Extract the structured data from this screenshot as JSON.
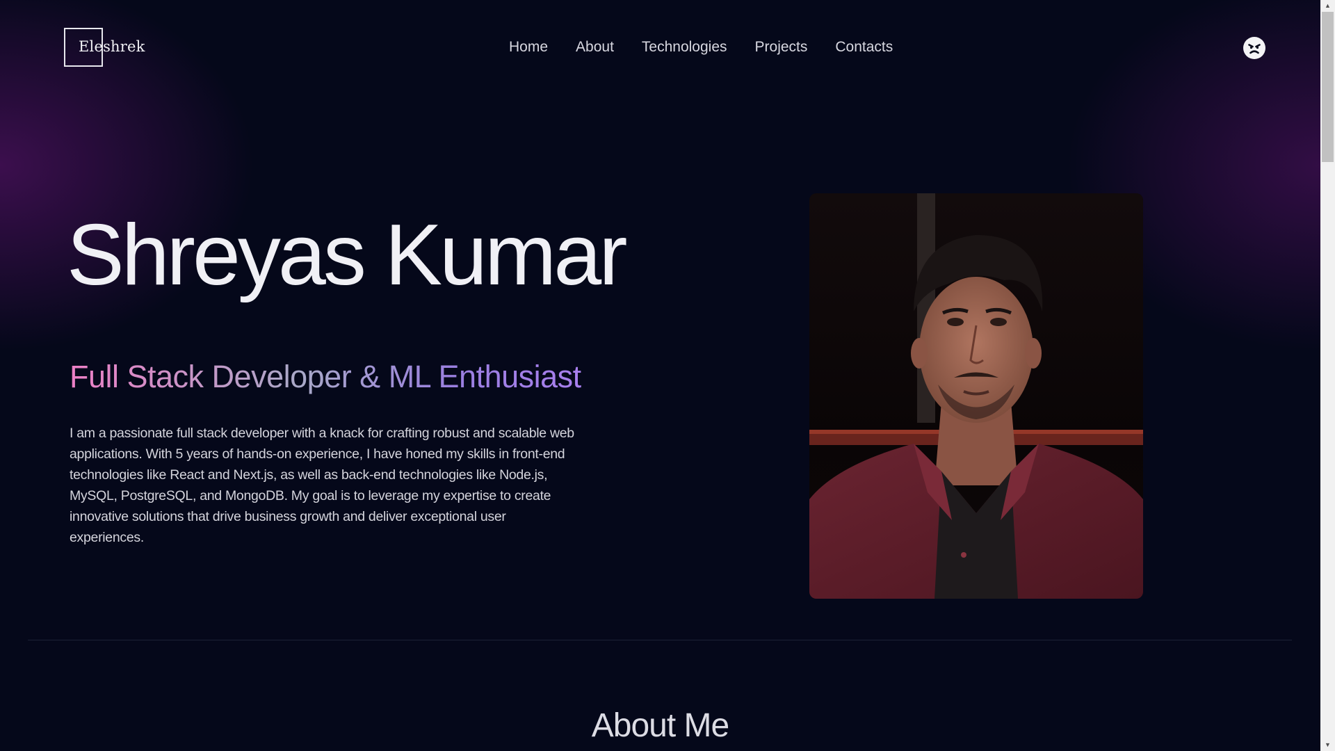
{
  "header": {
    "logo_text": "Eleshrek",
    "nav": [
      {
        "label": "Home"
      },
      {
        "label": "About"
      },
      {
        "label": "Technologies"
      },
      {
        "label": "Projects"
      },
      {
        "label": "Contacts"
      }
    ],
    "theme_toggle_icon": "angry-face-icon"
  },
  "hero": {
    "name": "Shreyas Kumar",
    "subtitle": "Full Stack Developer & ML Enthusiast",
    "bio": "I am a passionate full stack developer with a knack for crafting robust and scalable web applications. With 5 years of hands-on experience, I have honed my skills in front-end technologies like React and Next.js, as well as back-end technologies like Node.js, MySQL, PostgreSQL, and MongoDB. My goal is to leverage my expertise to create innovative solutions that drive business growth and deliver exceptional user experiences.",
    "photo_icon": "profile-photo"
  },
  "about": {
    "title": "About Me"
  },
  "colors": {
    "background": "#05081a",
    "accent_pink": "#ec7fc6",
    "accent_purple": "#a87fee",
    "glow": "#69147a"
  }
}
